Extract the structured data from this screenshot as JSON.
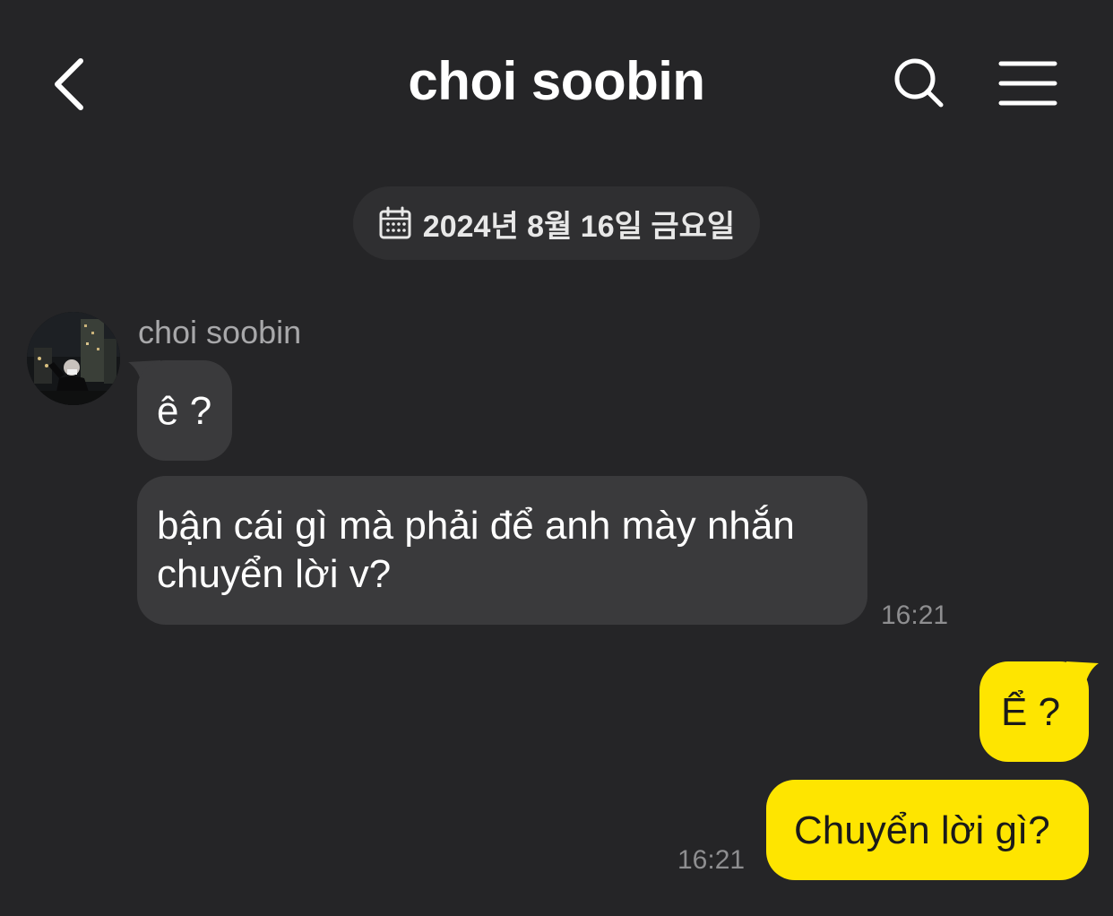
{
  "header": {
    "title": "choi soobin",
    "back_icon": "chevron-left-icon",
    "search_icon": "search-icon",
    "menu_icon": "hamburger-menu-icon"
  },
  "date_divider": {
    "icon": "calendar-icon",
    "text": "2024년 8월 16일 금요일"
  },
  "messages": [
    {
      "direction": "incoming",
      "sender": "choi soobin",
      "text": "ê ?"
    },
    {
      "direction": "incoming",
      "text": "bận cái gì mà phải để anh mày nhắn chuyển lời v?",
      "time": "16:21"
    },
    {
      "direction": "outgoing",
      "text": "Ể ?"
    },
    {
      "direction": "outgoing",
      "text": "Chuyển lời gì?",
      "time": "16:21"
    }
  ],
  "colors": {
    "background": "#252527",
    "incoming_bubble": "#3a3a3c",
    "outgoing_bubble": "#fee500",
    "date_pill": "#2f2f31"
  }
}
